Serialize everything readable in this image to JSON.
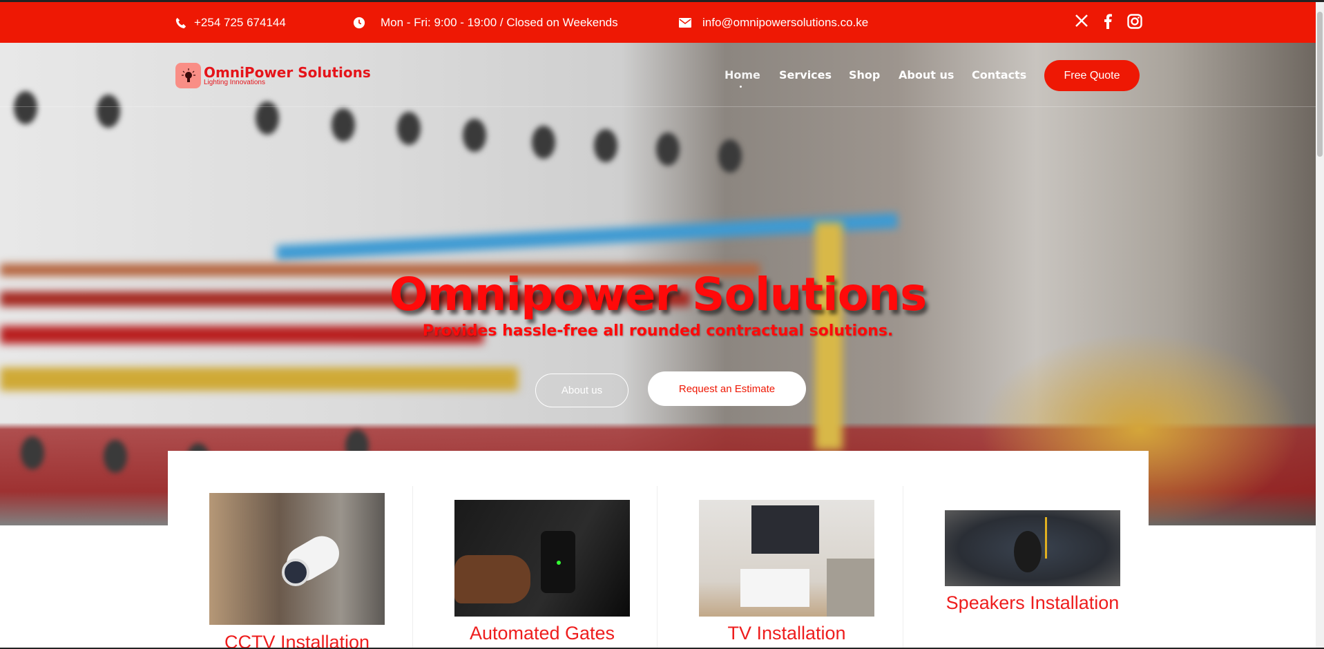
{
  "topbar": {
    "phone": "+254 725 674144",
    "hours": "Mon - Fri: 9:00 - 19:00 / Closed on Weekends",
    "email": "info@omnipowersolutions.co.ke",
    "social": [
      "x-icon",
      "facebook-icon",
      "instagram-icon"
    ]
  },
  "logo": {
    "name": "OmniPower Solutions",
    "tagline": "Lighting Innovations"
  },
  "nav": {
    "items": [
      "Home",
      "Services",
      "Shop",
      "About us",
      "Contacts"
    ],
    "active": "Home",
    "cta": "Free Quote"
  },
  "hero": {
    "title": "Omnipower Solutions",
    "subtitle": "Provides hassle-free all rounded contractual solutions.",
    "btn_about": "About us",
    "btn_estimate": "Request an Estimate"
  },
  "services": [
    {
      "title": "CCTV Installation"
    },
    {
      "title": "Automated Gates"
    },
    {
      "title": "TV Installation"
    },
    {
      "title": "Speakers Installation"
    }
  ],
  "colors": {
    "brand": "#ee1804",
    "title": "#ff0a0a"
  }
}
